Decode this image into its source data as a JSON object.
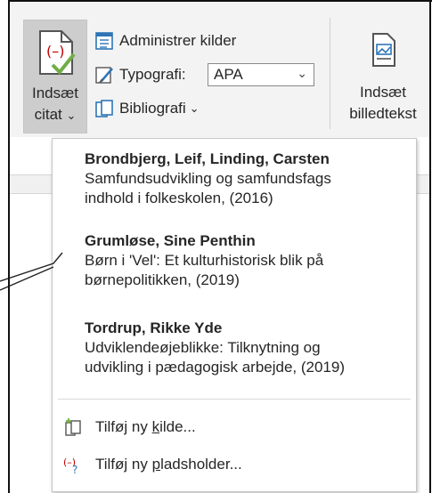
{
  "ribbon": {
    "insert_citation": {
      "line1": "Indsæt",
      "line2": "citat",
      "chevron": "⌄"
    },
    "manage_sources": "Administrer kilder",
    "style_label": "Typografi:",
    "style_value": "APA",
    "bibliography": "Bibliografi",
    "bibliography_chevron": "⌄",
    "insert_caption": {
      "line1": "Indsæt",
      "line2": "billedtekst"
    }
  },
  "menu": {
    "sources": [
      {
        "author": "Brondbjerg, Leif,  Linding, Carsten",
        "title_l1": "Samfundsudvikling og samfundsfags",
        "title_l2": "indhold i folkeskolen, (2016)"
      },
      {
        "author": "Grumløse, Sine Penthin",
        "title_l1": "Børn i 'Vel': Et kulturhistorisk blik på",
        "title_l2": "børnepolitikken, (2019)"
      },
      {
        "author": "Tordrup, Rikke Yde",
        "title_l1": "Udviklendeøjeblikke: Tilknytning og",
        "title_l2": "udvikling i pædagogisk arbejde, (2019)"
      }
    ],
    "add_source": {
      "pre": "Tilføj ny ",
      "key": "k",
      "post": "ilde..."
    },
    "add_placeholder": {
      "pre": "Tilføj ny ",
      "key": "p",
      "post": "ladsholder..."
    }
  },
  "colors": {
    "accent_green": "#70ad47",
    "accent_red": "#c00000",
    "accent_blue": "#2e75b6"
  }
}
